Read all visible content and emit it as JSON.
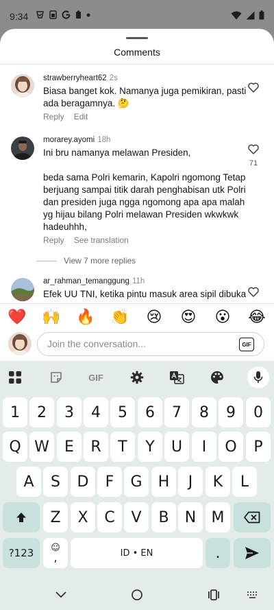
{
  "status_bar": {
    "time": "9:34",
    "left_icons": [
      "vpn-icon",
      "sim-icon",
      "google-icon",
      "battery-saver-icon",
      "dot-icon"
    ],
    "right_icons": [
      "wifi-icon",
      "signal-icon",
      "battery-icon"
    ]
  },
  "sheet": {
    "title": "Comments"
  },
  "comments": [
    {
      "username": "strawberryheart62",
      "time": "2s",
      "text": "Biasa banget kok. Namanya juga pemikiran, pasti ada beragamnya. 🤔",
      "actions": [
        "Reply",
        "Edit"
      ],
      "likes": ""
    },
    {
      "username": "morarey.ayomi",
      "time": "18h",
      "text": "Ini bru namanya melawan Presiden,\n\nbeda sama Polri kemarin, Kapolri ngomong Tetap berjuang sampai titik darah penghabisan utk Polri dan presiden juga ngga ngomong apa apa malah yg hijau bilang Polri melawan Presiden wkwkwk hadeuhhh,",
      "actions": [
        "Reply",
        "See translation"
      ],
      "likes": "71",
      "view_replies": "View 7 more replies"
    },
    {
      "username": "ar_rahman_temanggung",
      "time": "11h",
      "text": "Efek UU TNI, ketika pintu masuk area sipil dibuka",
      "actions": [],
      "likes": ""
    }
  ],
  "composer": {
    "emojis": [
      "❤️",
      "🙌",
      "🔥",
      "👏",
      "😢",
      "😍",
      "😮",
      "😂"
    ],
    "placeholder": "Join the conversation...",
    "gif_label": "GIF"
  },
  "keyboard": {
    "toolbar": {
      "gif_label": "GIF",
      "icons": [
        "apps-grid-icon",
        "sticker-icon",
        "gif-icon",
        "settings-gear-icon",
        "translate-icon",
        "palette-icon",
        "microphone-icon"
      ]
    },
    "rows": [
      [
        "1",
        "2",
        "3",
        "4",
        "5",
        "6",
        "7",
        "8",
        "9",
        "0"
      ],
      [
        "Q",
        "W",
        "E",
        "R",
        "T",
        "Y",
        "U",
        "I",
        "O",
        "P"
      ],
      [
        "A",
        "S",
        "D",
        "F",
        "G",
        "H",
        "J",
        "K",
        "L"
      ],
      [
        "Z",
        "X",
        "C",
        "V",
        "B",
        "N",
        "M"
      ]
    ],
    "symbols_label": "?123",
    "comma_label": ",",
    "space_label": "ID • EN",
    "period_label": "."
  },
  "nav_bar": {
    "icons": [
      "back-chevron-icon",
      "home-circle-icon",
      "recents-icon",
      "keyboard-switch-icon"
    ]
  },
  "colors": {
    "sheet_bg": "#ffffff",
    "keyboard_bg": "#e4ecea",
    "special_key_bg": "#c9e1dc",
    "dim_overlay": "#8c8c8c"
  }
}
